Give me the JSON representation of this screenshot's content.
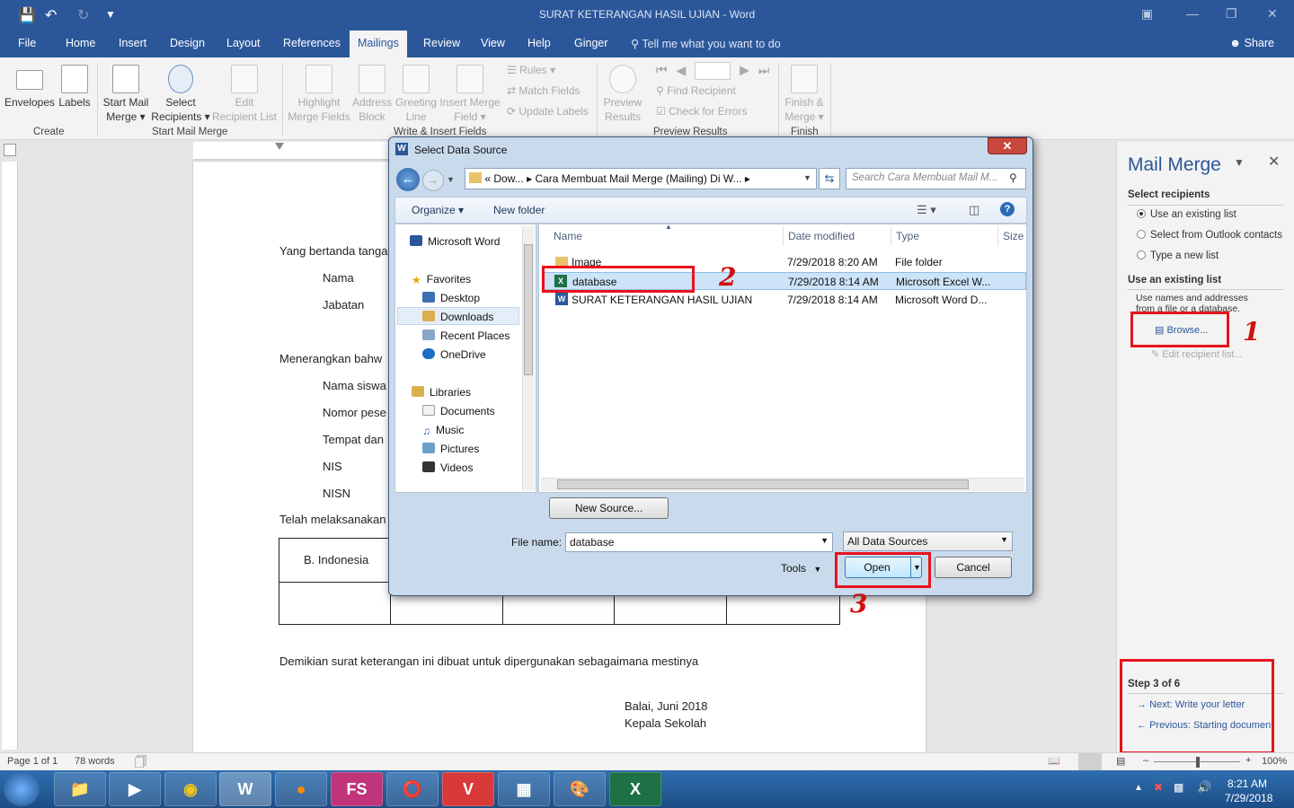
{
  "window": {
    "title": "SURAT KETERANGAN HASIL UJIAN  -  Word"
  },
  "quick_access": {
    "save_icon": "save-icon",
    "undo_icon": "undo-icon",
    "redo_icon": "redo-icon"
  },
  "tabs": [
    "File",
    "Home",
    "Insert",
    "Design",
    "Layout",
    "References",
    "Mailings",
    "Review",
    "View",
    "Help",
    "Ginger"
  ],
  "active_tab": "Mailings",
  "tell_me": "Tell me what you want to do",
  "share": "Share",
  "ribbon": {
    "create": {
      "label": "Create",
      "envelopes": "Envelopes",
      "labels": "Labels"
    },
    "start": {
      "label": "Start Mail Merge",
      "start_l1": "Start Mail",
      "start_l2": "Merge",
      "select_l1": "Select",
      "select_l2": "Recipients",
      "edit_l1": "Edit",
      "edit_l2": "Recipient List"
    },
    "write": {
      "label": "Write & Insert Fields",
      "highlight_l1": "Highlight",
      "highlight_l2": "Merge Fields",
      "address_l1": "Address",
      "address_l2": "Block",
      "greeting_l1": "Greeting",
      "greeting_l2": "Line",
      "insert_l1": "Insert Merge",
      "insert_l2": "Field",
      "rules": "Rules",
      "match": "Match Fields",
      "update": "Update Labels"
    },
    "preview": {
      "label": "Preview Results",
      "preview_l1": "Preview",
      "preview_l2": "Results",
      "find": "Find Recipient",
      "check": "Check for Errors"
    },
    "finish": {
      "label": "Finish",
      "finish_l1": "Finish &",
      "finish_l2": "Merge"
    }
  },
  "document": {
    "line1": "Yang bertanda tanga",
    "nama": "Nama",
    "jabatan": "Jabatan",
    "line2": "Menerangkan bahw",
    "nama_siswa": "Nama siswa",
    "nomor": "Nomor pese",
    "tempat": "Tempat dan",
    "nis": "NIS",
    "nisn": "NISN",
    "line3": "Telah melaksanakan",
    "table_first": "B. Indonesia",
    "closing": "Demikian surat keterangan ini dibuat untuk dipergunakan sebagaimana mestinya",
    "place_date": "Balai, Juni 2018",
    "signer": "Kepala Sekolah"
  },
  "pane": {
    "title": "Mail Merge",
    "select_recipients": "Select recipients",
    "options": [
      "Use an existing list",
      "Select from Outlook contacts",
      "Type a new list"
    ],
    "use_existing": "Use an existing list",
    "desc_l1": "Use names and addresses",
    "desc_l2": "from a file or a database.",
    "browse": "Browse...",
    "edit_list": "Edit recipient list...",
    "step": "Step 3 of 6",
    "next": "Next: Write your letter",
    "previous": "Previous: Starting document"
  },
  "annotations": {
    "n1": "1",
    "n2": "2",
    "n3": "3"
  },
  "dialog": {
    "title": "Select Data Source",
    "address_prefix": "«",
    "address_1": "Dow...",
    "address_sep": "▸",
    "address_2": "Cara Membuat Mail Merge (Mailing) Di W...",
    "address_end": "▸",
    "search": "Search Cara Membuat Mail M...",
    "organize": "Organize ▾",
    "new_folder": "New folder",
    "nav": {
      "word": "Microsoft Word",
      "favorites": "Favorites",
      "desktop": "Desktop",
      "downloads": "Downloads",
      "recent": "Recent Places",
      "onedrive": "OneDrive",
      "libraries": "Libraries",
      "documents": "Documents",
      "music": "Music",
      "pictures": "Pictures",
      "videos": "Videos"
    },
    "columns": {
      "name": "Name",
      "date": "Date modified",
      "type": "Type",
      "size": "Size"
    },
    "files": [
      {
        "name": "Image",
        "date": "7/29/2018 8:20 AM",
        "type": "File folder"
      },
      {
        "name": "database",
        "date": "7/29/2018 8:14 AM",
        "type": "Microsoft Excel W..."
      },
      {
        "name": "SURAT KETERANGAN HASIL UJIAN",
        "date": "7/29/2018 8:14 AM",
        "type": "Microsoft Word D..."
      }
    ],
    "new_source": "New Source...",
    "file_name_label": "File name:",
    "file_name": "database",
    "filter": "All Data Sources",
    "tools": "Tools",
    "open": "Open",
    "cancel": "Cancel"
  },
  "status": {
    "page": "Page 1 of 1",
    "words": "78 words",
    "zoom": "100%"
  },
  "clock": {
    "time": "8:21 AM",
    "date": "7/29/2018"
  },
  "taskbar": {
    "fs": "FS"
  },
  "colors": {
    "word_blue": "#2b579a",
    "annotation_red": "#e8121c",
    "taskbar": "#1c4d86"
  }
}
